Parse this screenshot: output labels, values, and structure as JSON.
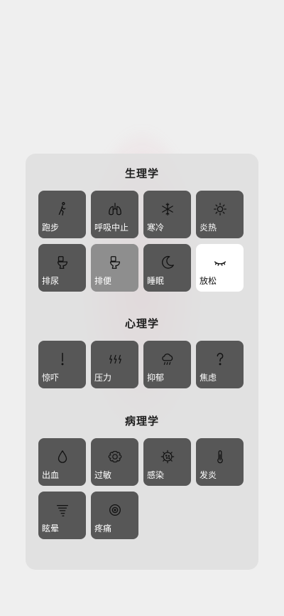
{
  "sections": [
    {
      "title": "生理学",
      "items": [
        {
          "label": "跑步",
          "icon": "running-figure-icon"
        },
        {
          "label": "呼吸中止",
          "icon": "lungs-icon"
        },
        {
          "label": "寒冷",
          "icon": "snowflake-icon"
        },
        {
          "label": "炎热",
          "icon": "sun-icon"
        },
        {
          "label": "排尿",
          "icon": "toilet-icon"
        },
        {
          "label": "排便",
          "icon": "toilet-icon"
        },
        {
          "label": "睡眠",
          "icon": "moon-icon"
        },
        {
          "label": "放松",
          "icon": "closed-eye-icon",
          "selected": true
        }
      ]
    },
    {
      "title": "心理学",
      "items": [
        {
          "label": "惊吓",
          "icon": "exclamation-icon"
        },
        {
          "label": "压力",
          "icon": "lightning-icon"
        },
        {
          "label": "抑郁",
          "icon": "rain-cloud-icon"
        },
        {
          "label": "焦虑",
          "icon": "question-icon"
        }
      ]
    },
    {
      "title": "病理学",
      "items": [
        {
          "label": "出血",
          "icon": "drop-icon"
        },
        {
          "label": "过敏",
          "icon": "flower-icon"
        },
        {
          "label": "感染",
          "icon": "virus-icon"
        },
        {
          "label": "发炎",
          "icon": "thermometer-icon"
        },
        {
          "label": "眩晕",
          "icon": "tornado-icon"
        },
        {
          "label": "疼痛",
          "icon": "target-icon"
        }
      ]
    }
  ],
  "colors": {
    "tile": "#575757",
    "tile_highlight": "#8e8e8e",
    "tile_selected": "#ffffff",
    "panel": "#dedede",
    "glow": "#e88ca0"
  }
}
